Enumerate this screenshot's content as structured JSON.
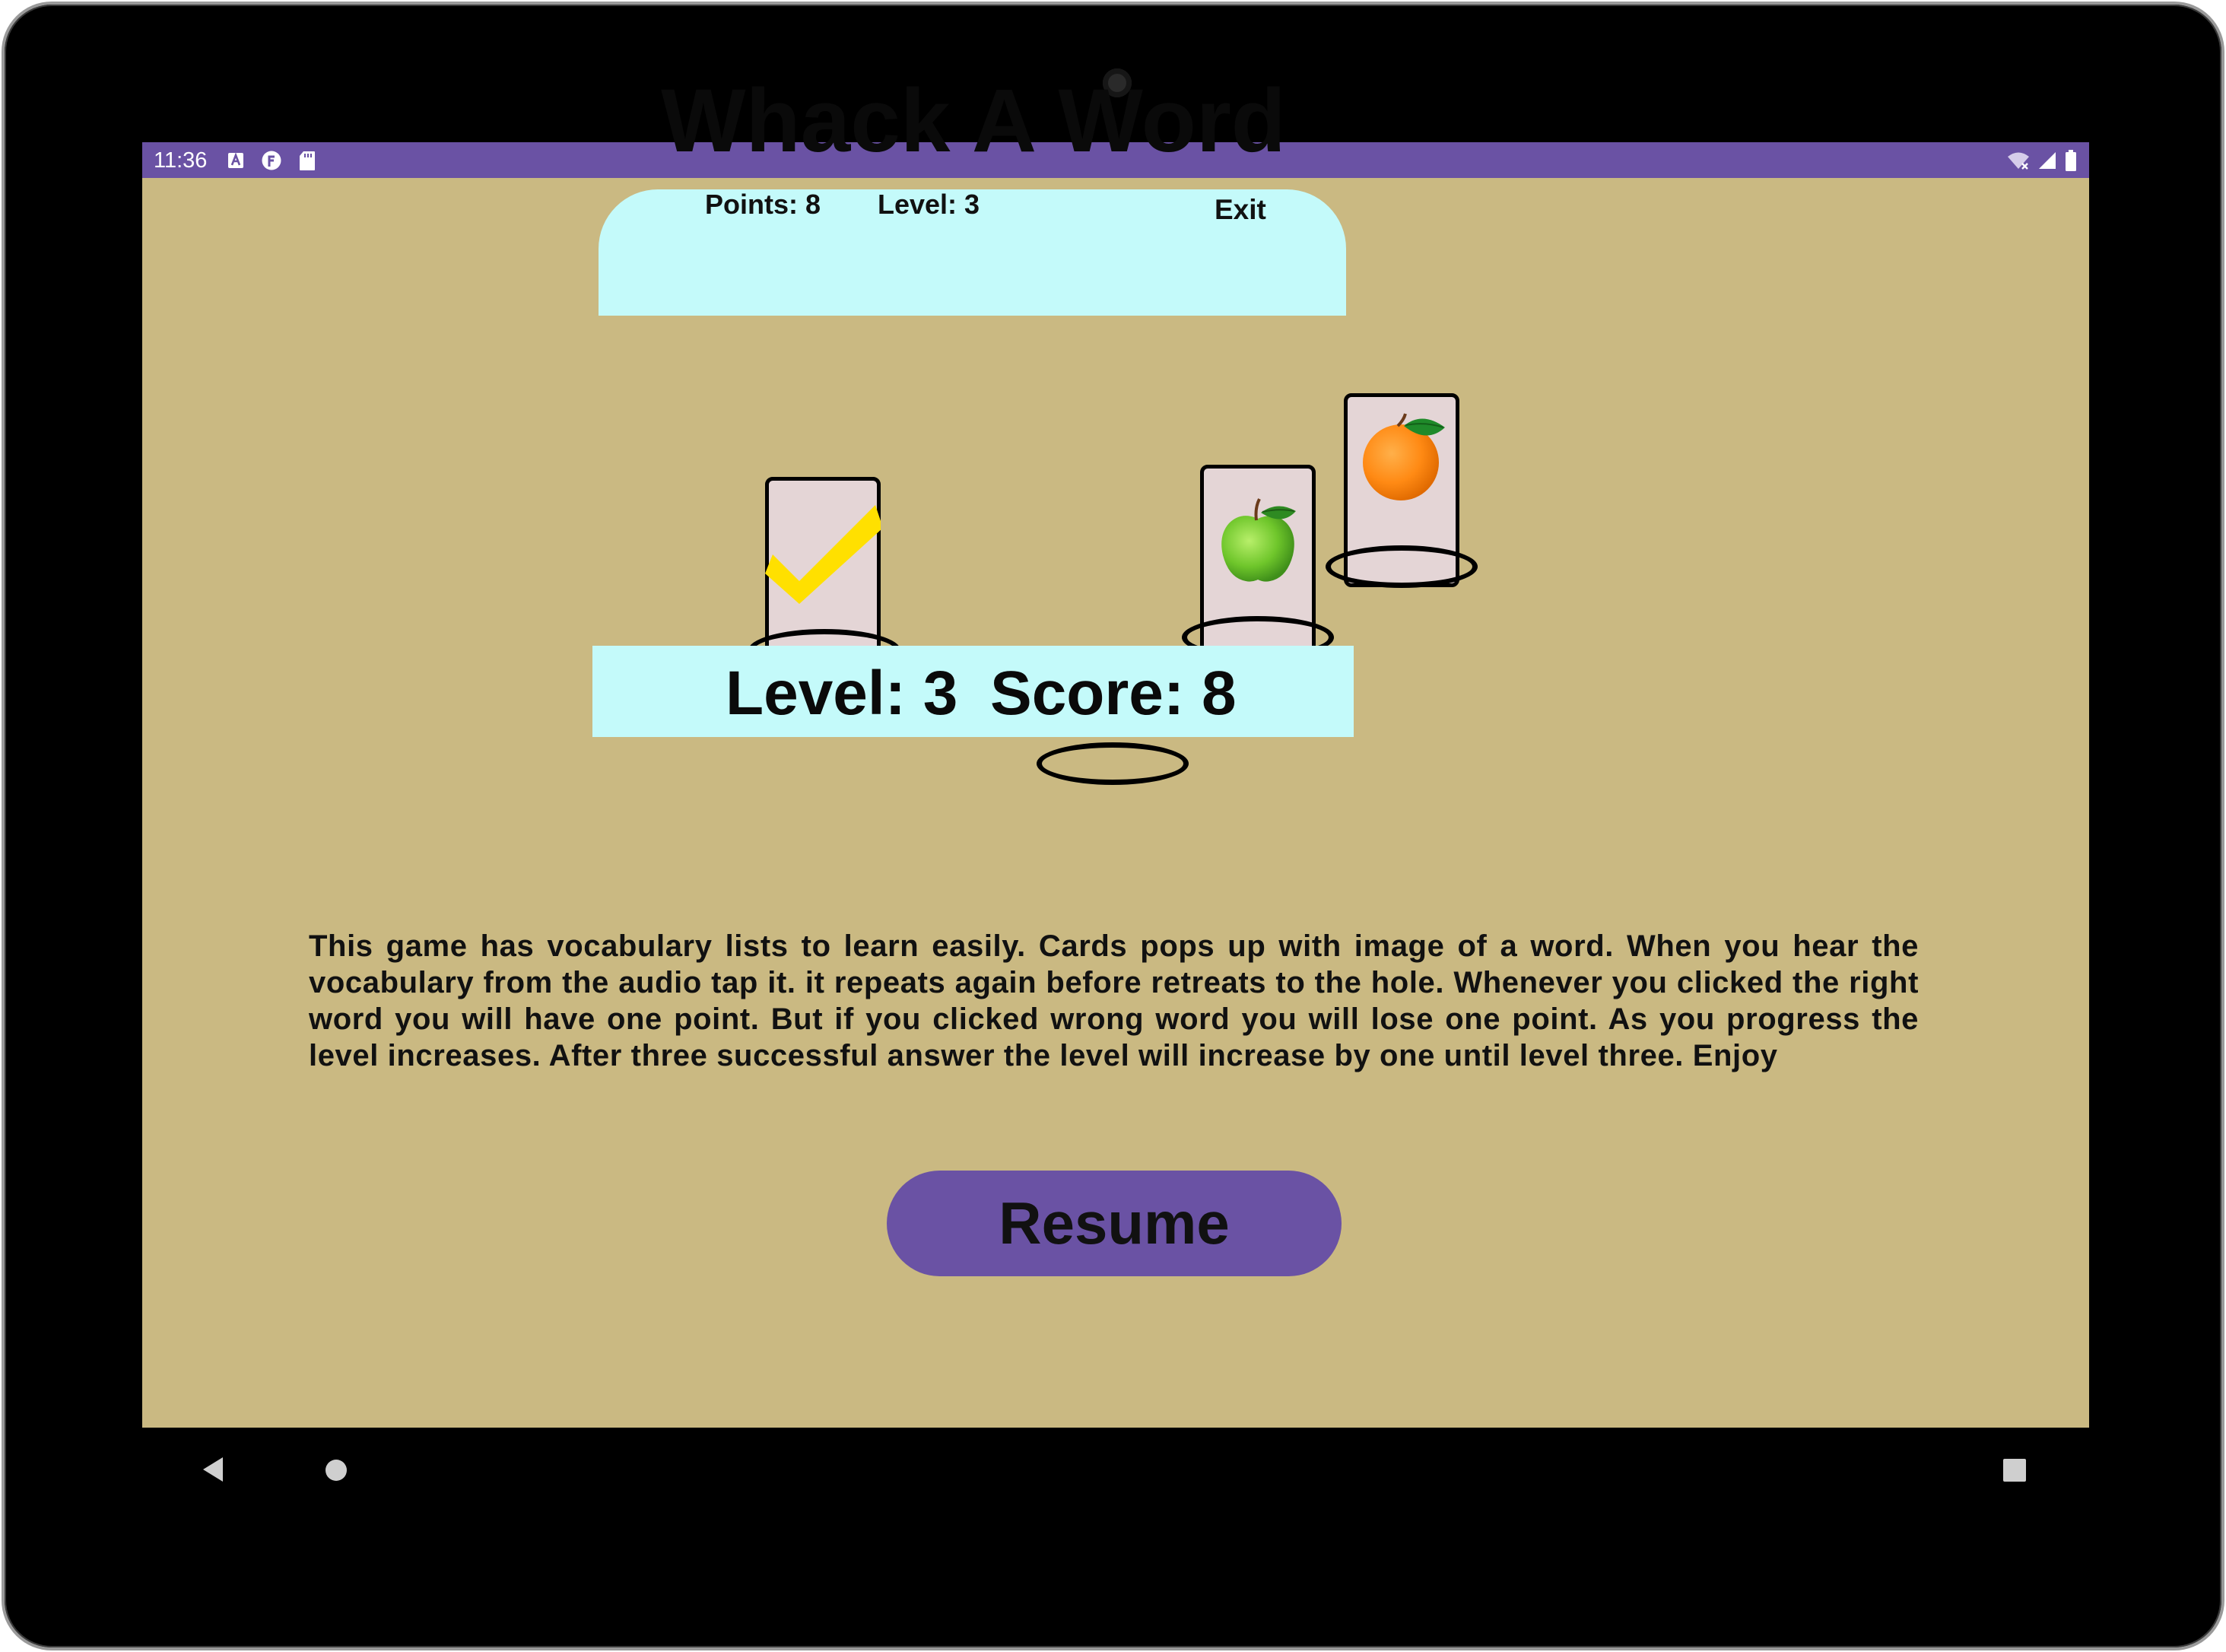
{
  "status_bar": {
    "time": "11:36",
    "left_icons": [
      "a-badge-icon",
      "f-badge-icon",
      "sd-card-icon"
    ],
    "right_icons": [
      "wifi-off-icon",
      "signal-icon",
      "battery-icon"
    ],
    "color": "#6a52a4"
  },
  "game": {
    "title": "Whack A Word",
    "hud": {
      "points_label": "Points: 8",
      "level_label": "Level: 3",
      "exit_label": "Exit"
    },
    "cards": [
      {
        "image": "checkmark-icon"
      },
      {
        "image": "green-apple-icon"
      },
      {
        "image": "orange-icon"
      }
    ],
    "holes_count": 5,
    "score_banner": {
      "level_text": "Level: 3",
      "score_text": "Score: 8"
    }
  },
  "instructions": "This game has vocabulary lists to learn easily. Cards pops up with image of a word. When you hear the vocabulary from the audio tap it. it repeats again before retreats to the hole. Whenever you clicked the right word you will have one point. But if you clicked wrong word you will lose one point. As you progress the level increases. After three successful answer the level will increase by one until level three. Enjoy",
  "resume_button": {
    "label": "Resume"
  },
  "nav_bar": {
    "icons": [
      "back-icon",
      "home-icon",
      "recents-icon"
    ]
  },
  "colors": {
    "background": "#cab982",
    "panel": "#c4fafa",
    "accent": "#6a52a4",
    "card": "#e4d5d6"
  }
}
